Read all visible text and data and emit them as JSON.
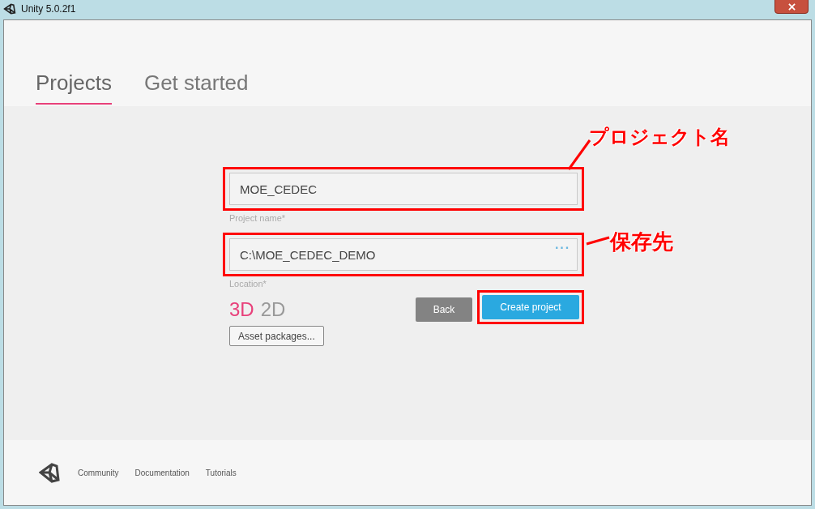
{
  "window": {
    "title": "Unity 5.0.2f1"
  },
  "tabs": [
    {
      "label": "Projects",
      "selected": true
    },
    {
      "label": "Get started",
      "selected": false
    }
  ],
  "form": {
    "project_name": {
      "value": "MOE_CEDEC",
      "label": "Project name*"
    },
    "location": {
      "value": "C:\\MOE_CEDEC_DEMO",
      "label": "Location*",
      "browse": "···"
    },
    "modes": [
      {
        "label": "3D",
        "selected": true
      },
      {
        "label": "2D",
        "selected": false
      }
    ],
    "asset_button": "Asset packages...",
    "back_button": "Back",
    "create_button": "Create project"
  },
  "annotations": [
    {
      "text": "プロジェクト名"
    },
    {
      "text": "保存先"
    }
  ],
  "footer": {
    "links": [
      "Community",
      "Documentation",
      "Tutorials"
    ]
  }
}
